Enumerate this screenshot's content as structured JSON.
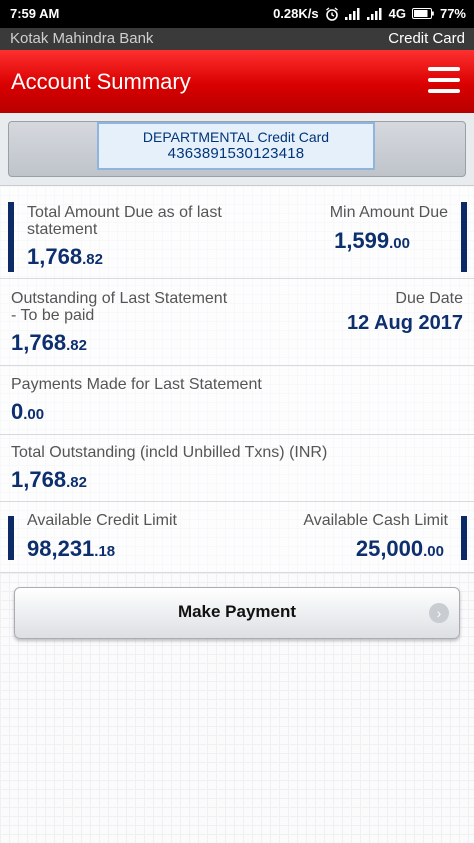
{
  "status_bar": {
    "time": "7:59 AM",
    "speed": "0.28K/s",
    "network": "4G",
    "battery": "77%"
  },
  "bank_bar": {
    "bank_name": "Kotak Mahindra Bank",
    "section": "Credit Card"
  },
  "header": {
    "title": "Account Summary",
    "menu_icon": "hamburger-menu-icon"
  },
  "card": {
    "name": "DEPARTMENTAL Credit Card",
    "number": "4363891530123418"
  },
  "summary": {
    "total_due_label": "Total Amount Due as of last statement",
    "total_due_int": "1,768",
    "total_due_dec": ".82",
    "min_due_label": "Min Amount Due",
    "min_due_int": "1,599",
    "min_due_dec": ".00",
    "outstanding_label_1": "Outstanding of Last Statement",
    "outstanding_label_2": "- To be paid",
    "outstanding_int": "1,768",
    "outstanding_dec": ".82",
    "due_date_label": "Due Date",
    "due_date": "12 Aug 2017",
    "payments_label": "Payments Made for Last Statement",
    "payments_int": "0",
    "payments_dec": ".00",
    "total_outstanding_label": "Total Outstanding (incld Unbilled Txns) (INR)",
    "total_outstanding_int": "1,768",
    "total_outstanding_dec": ".82",
    "avail_credit_label": "Available Credit Limit",
    "avail_credit_int": "98,231",
    "avail_credit_dec": ".18",
    "avail_cash_label": "Available Cash Limit",
    "avail_cash_int": "25,000",
    "avail_cash_dec": ".00"
  },
  "actions": {
    "make_payment": "Make Payment"
  },
  "colors": {
    "header_red": "#d90000",
    "amount_blue": "#0d2f6e"
  }
}
